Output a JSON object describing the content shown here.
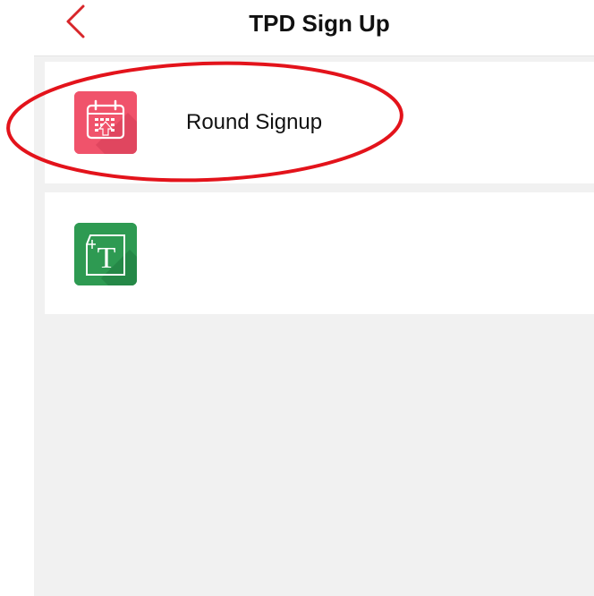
{
  "header": {
    "title": "TPD Sign Up",
    "back_icon": "chevron-left-icon"
  },
  "list": {
    "items": [
      {
        "label": "Round Signup",
        "icon": "calendar-upload-icon",
        "icon_color": "#f0536b"
      },
      {
        "label": "",
        "icon": "text-document-icon",
        "icon_color": "#2e9a52"
      }
    ]
  },
  "annotation": {
    "type": "ellipse-highlight",
    "color": "#e3131b",
    "target": "Round Signup"
  },
  "colors": {
    "accent": "#d8262a",
    "background": "#f1f1f1"
  }
}
